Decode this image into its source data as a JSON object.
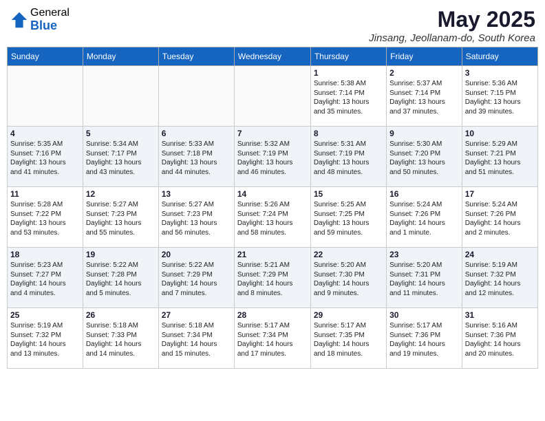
{
  "header": {
    "logo_general": "General",
    "logo_blue": "Blue",
    "title": "May 2025",
    "location": "Jinsang, Jeollanam-do, South Korea"
  },
  "days_of_week": [
    "Sunday",
    "Monday",
    "Tuesday",
    "Wednesday",
    "Thursday",
    "Friday",
    "Saturday"
  ],
  "weeks": [
    [
      {
        "day": "",
        "info": ""
      },
      {
        "day": "",
        "info": ""
      },
      {
        "day": "",
        "info": ""
      },
      {
        "day": "",
        "info": ""
      },
      {
        "day": "1",
        "info": "Sunrise: 5:38 AM\nSunset: 7:14 PM\nDaylight: 13 hours\nand 35 minutes."
      },
      {
        "day": "2",
        "info": "Sunrise: 5:37 AM\nSunset: 7:14 PM\nDaylight: 13 hours\nand 37 minutes."
      },
      {
        "day": "3",
        "info": "Sunrise: 5:36 AM\nSunset: 7:15 PM\nDaylight: 13 hours\nand 39 minutes."
      }
    ],
    [
      {
        "day": "4",
        "info": "Sunrise: 5:35 AM\nSunset: 7:16 PM\nDaylight: 13 hours\nand 41 minutes."
      },
      {
        "day": "5",
        "info": "Sunrise: 5:34 AM\nSunset: 7:17 PM\nDaylight: 13 hours\nand 43 minutes."
      },
      {
        "day": "6",
        "info": "Sunrise: 5:33 AM\nSunset: 7:18 PM\nDaylight: 13 hours\nand 44 minutes."
      },
      {
        "day": "7",
        "info": "Sunrise: 5:32 AM\nSunset: 7:19 PM\nDaylight: 13 hours\nand 46 minutes."
      },
      {
        "day": "8",
        "info": "Sunrise: 5:31 AM\nSunset: 7:19 PM\nDaylight: 13 hours\nand 48 minutes."
      },
      {
        "day": "9",
        "info": "Sunrise: 5:30 AM\nSunset: 7:20 PM\nDaylight: 13 hours\nand 50 minutes."
      },
      {
        "day": "10",
        "info": "Sunrise: 5:29 AM\nSunset: 7:21 PM\nDaylight: 13 hours\nand 51 minutes."
      }
    ],
    [
      {
        "day": "11",
        "info": "Sunrise: 5:28 AM\nSunset: 7:22 PM\nDaylight: 13 hours\nand 53 minutes."
      },
      {
        "day": "12",
        "info": "Sunrise: 5:27 AM\nSunset: 7:23 PM\nDaylight: 13 hours\nand 55 minutes."
      },
      {
        "day": "13",
        "info": "Sunrise: 5:27 AM\nSunset: 7:23 PM\nDaylight: 13 hours\nand 56 minutes."
      },
      {
        "day": "14",
        "info": "Sunrise: 5:26 AM\nSunset: 7:24 PM\nDaylight: 13 hours\nand 58 minutes."
      },
      {
        "day": "15",
        "info": "Sunrise: 5:25 AM\nSunset: 7:25 PM\nDaylight: 13 hours\nand 59 minutes."
      },
      {
        "day": "16",
        "info": "Sunrise: 5:24 AM\nSunset: 7:26 PM\nDaylight: 14 hours\nand 1 minute."
      },
      {
        "day": "17",
        "info": "Sunrise: 5:24 AM\nSunset: 7:26 PM\nDaylight: 14 hours\nand 2 minutes."
      }
    ],
    [
      {
        "day": "18",
        "info": "Sunrise: 5:23 AM\nSunset: 7:27 PM\nDaylight: 14 hours\nand 4 minutes."
      },
      {
        "day": "19",
        "info": "Sunrise: 5:22 AM\nSunset: 7:28 PM\nDaylight: 14 hours\nand 5 minutes."
      },
      {
        "day": "20",
        "info": "Sunrise: 5:22 AM\nSunset: 7:29 PM\nDaylight: 14 hours\nand 7 minutes."
      },
      {
        "day": "21",
        "info": "Sunrise: 5:21 AM\nSunset: 7:29 PM\nDaylight: 14 hours\nand 8 minutes."
      },
      {
        "day": "22",
        "info": "Sunrise: 5:20 AM\nSunset: 7:30 PM\nDaylight: 14 hours\nand 9 minutes."
      },
      {
        "day": "23",
        "info": "Sunrise: 5:20 AM\nSunset: 7:31 PM\nDaylight: 14 hours\nand 11 minutes."
      },
      {
        "day": "24",
        "info": "Sunrise: 5:19 AM\nSunset: 7:32 PM\nDaylight: 14 hours\nand 12 minutes."
      }
    ],
    [
      {
        "day": "25",
        "info": "Sunrise: 5:19 AM\nSunset: 7:32 PM\nDaylight: 14 hours\nand 13 minutes."
      },
      {
        "day": "26",
        "info": "Sunrise: 5:18 AM\nSunset: 7:33 PM\nDaylight: 14 hours\nand 14 minutes."
      },
      {
        "day": "27",
        "info": "Sunrise: 5:18 AM\nSunset: 7:34 PM\nDaylight: 14 hours\nand 15 minutes."
      },
      {
        "day": "28",
        "info": "Sunrise: 5:17 AM\nSunset: 7:34 PM\nDaylight: 14 hours\nand 17 minutes."
      },
      {
        "day": "29",
        "info": "Sunrise: 5:17 AM\nSunset: 7:35 PM\nDaylight: 14 hours\nand 18 minutes."
      },
      {
        "day": "30",
        "info": "Sunrise: 5:17 AM\nSunset: 7:36 PM\nDaylight: 14 hours\nand 19 minutes."
      },
      {
        "day": "31",
        "info": "Sunrise: 5:16 AM\nSunset: 7:36 PM\nDaylight: 14 hours\nand 20 minutes."
      }
    ]
  ]
}
